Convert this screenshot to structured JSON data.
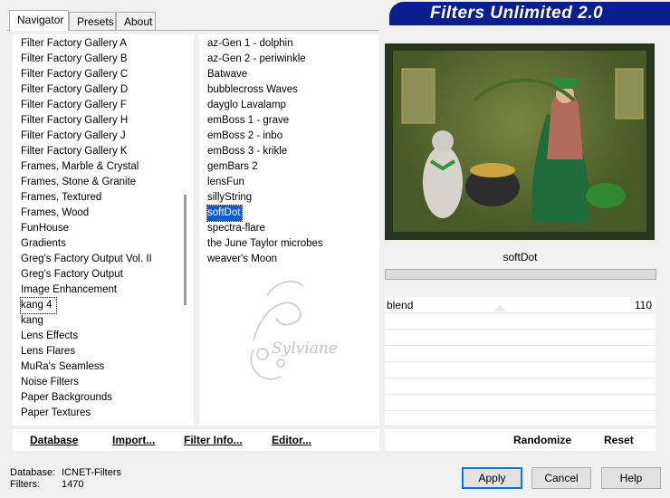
{
  "tabs": [
    {
      "label": "Navigator"
    },
    {
      "label": "Presets"
    },
    {
      "label": "About"
    }
  ],
  "banner": {
    "title": "Filters Unlimited 2.0"
  },
  "categories": [
    "Filter Factory Gallery A",
    "Filter Factory Gallery B",
    "Filter Factory Gallery C",
    "Filter Factory Gallery D",
    "Filter Factory Gallery F",
    "Filter Factory Gallery H",
    "Filter Factory Gallery J",
    "Filter Factory Gallery K",
    "Frames, Marble & Crystal",
    "Frames, Stone & Granite",
    "Frames, Textured",
    "Frames, Wood",
    "FunHouse",
    "Gradients",
    "Greg's Factory Output Vol. II",
    "Greg's Factory Output",
    "Image Enhancement",
    "kang 4",
    "kang",
    "Lens Effects",
    "Lens Flares",
    "MuRa's Seamless",
    "Noise Filters",
    "Paper Backgrounds",
    "Paper Textures"
  ],
  "filters": [
    "az-Gen 1  -  dolphin",
    "az-Gen 2  -  periwinkle",
    "Batwave",
    "bubblecross Waves",
    "dayglo Lavalamp",
    "emBoss 1  -  grave",
    "emBoss 2  -  inbo",
    "emBoss 3  -  krikle",
    "gemBars 2",
    "lensFun",
    "sillyString",
    "softDot",
    "spectra-flare",
    "the June Taylor microbes",
    "weaver's Moon"
  ],
  "watermark": {
    "text": "Sylviane"
  },
  "filter_name": "softDot",
  "parameters": [
    {
      "name": "blend",
      "value": "110"
    }
  ],
  "toolbar": {
    "database": "Database",
    "import": "Import...",
    "filter_info": "Filter Info...",
    "editor": "Editor...",
    "randomize": "Randomize",
    "reset": "Reset"
  },
  "status": {
    "database_label": "Database:",
    "database_value": "ICNET-Filters",
    "filters_label": "Filters:",
    "filters_value": "1470"
  },
  "buttons": {
    "apply": "Apply",
    "cancel": "Cancel",
    "help": "Help"
  }
}
